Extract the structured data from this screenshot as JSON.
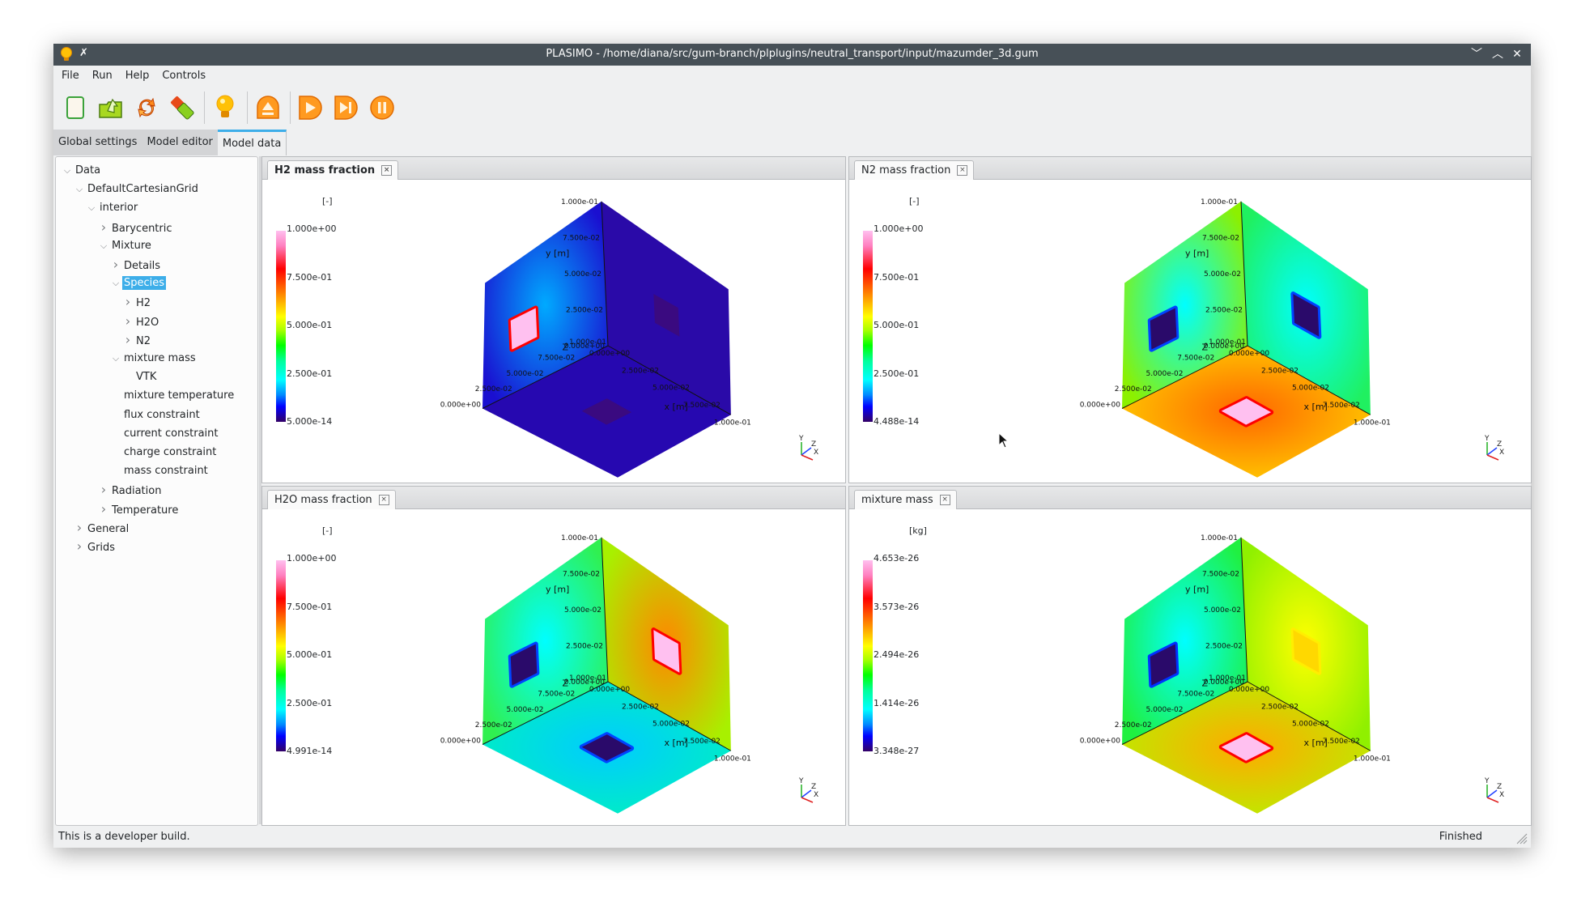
{
  "window": {
    "title": "PLASIMO - /home/diana/src/gum-branch/plplugins/neutral_transport/input/mazumder_3d.gum",
    "controls": [
      "minimize-icon",
      "maximize-icon",
      "close-icon"
    ]
  },
  "menu": [
    "File",
    "Run",
    "Help",
    "Controls"
  ],
  "toolbar": [
    {
      "name": "new-document-icon",
      "label": "New"
    },
    {
      "name": "open-folder-icon",
      "label": "Open"
    },
    {
      "name": "reload-icon",
      "label": "Reload"
    },
    {
      "name": "usb-stick-icon",
      "label": "Save"
    },
    {
      "name": "lightbulb-icon",
      "label": "Hint"
    },
    {
      "name": "eject-icon",
      "label": "Eject"
    },
    {
      "name": "play-icon",
      "label": "Run"
    },
    {
      "name": "step-icon",
      "label": "Step"
    },
    {
      "name": "pause-icon",
      "label": "Pause"
    }
  ],
  "tabs": [
    {
      "label": "Global settings",
      "active": false
    },
    {
      "label": "Model editor",
      "active": false
    },
    {
      "label": "Model data",
      "active": true
    }
  ],
  "tree": [
    {
      "label": "Data",
      "level": 0,
      "expander": "open"
    },
    {
      "label": "DefaultCartesianGrid",
      "level": 1,
      "expander": "open"
    },
    {
      "label": "interior",
      "level": 2,
      "expander": "open"
    },
    {
      "label": "Barycentric",
      "level": 3,
      "expander": "closed"
    },
    {
      "label": "Mixture",
      "level": 3,
      "expander": "open"
    },
    {
      "label": "Details",
      "level": 4,
      "expander": "closed"
    },
    {
      "label": "Species",
      "level": 4,
      "expander": "open",
      "selected": true
    },
    {
      "label": "H2",
      "level": 5,
      "expander": "closed"
    },
    {
      "label": "H2O",
      "level": 5,
      "expander": "closed"
    },
    {
      "label": "N2",
      "level": 5,
      "expander": "closed"
    },
    {
      "label": "mixture mass",
      "level": 4,
      "expander": "open"
    },
    {
      "label": "VTK",
      "level": 5,
      "expander": "none"
    },
    {
      "label": "mixture temperature",
      "level": 4,
      "expander": "none"
    },
    {
      "label": "flux constraint",
      "level": 4,
      "expander": "none"
    },
    {
      "label": "current constraint",
      "level": 4,
      "expander": "none"
    },
    {
      "label": "charge constraint",
      "level": 4,
      "expander": "none"
    },
    {
      "label": "mass constraint",
      "level": 4,
      "expander": "none"
    },
    {
      "label": "Radiation",
      "level": 3,
      "expander": "closed"
    },
    {
      "label": "Temperature",
      "level": 3,
      "expander": "closed"
    },
    {
      "label": "General",
      "level": 1,
      "expander": "closed"
    },
    {
      "label": "Grids",
      "level": 1,
      "expander": "closed"
    }
  ],
  "panels": [
    {
      "tab": "H2 mass fraction",
      "active": true,
      "unit": "[-]",
      "colorbar": [
        "1.000e+00",
        "7.500e-01",
        "5.000e-01",
        "2.500e-01",
        "5.000e-14"
      ],
      "faces": {
        "left": "#1a0fd0",
        "right": "#2a0aa8",
        "bottom": "#2608b0"
      },
      "source_left": {
        "color": "#ffc0f0",
        "ring": "#ff0000",
        "halo": "#00aaff"
      },
      "source_right": {
        "color": "#3a0a80"
      },
      "source_bottom": {
        "color": "#3a0a80"
      }
    },
    {
      "tab": "N2 mass fraction",
      "active": false,
      "unit": "[-]",
      "colorbar": [
        "1.000e+00",
        "7.500e-01",
        "5.000e-01",
        "2.500e-01",
        "4.488e-14"
      ],
      "faces": {
        "left": "#8cf000",
        "right": "#20f060",
        "bottom": "#ffd000"
      },
      "source_left": {
        "color": "#2a0a6a",
        "ring": "#0044ff",
        "halo": "#00ffff"
      },
      "source_right": {
        "color": "#2a0a6a",
        "ring": "#0044ff",
        "halo": "#00ffff"
      },
      "source_bottom": {
        "color": "#ffc0f0",
        "ring": "#ff0000",
        "halo": "#ff6600"
      }
    },
    {
      "tab": "H2O mass fraction",
      "active": false,
      "unit": "[-]",
      "colorbar": [
        "1.000e+00",
        "7.500e-01",
        "5.000e-01",
        "2.500e-01",
        "4.991e-14"
      ],
      "faces": {
        "left": "#30f050",
        "right": "#a8f000",
        "bottom": "#00f0c0"
      },
      "source_left": {
        "color": "#2a0a6a",
        "ring": "#0044ff",
        "halo": "#00ffff"
      },
      "source_right": {
        "color": "#ffc0f0",
        "ring": "#ff0000",
        "halo": "#ff8800"
      },
      "source_bottom": {
        "color": "#2a0a6a",
        "ring": "#0044ff",
        "halo": "#00ccff"
      }
    },
    {
      "tab": "mixture mass",
      "active": false,
      "unit": "[kg]",
      "colorbar": [
        "4.653e-26",
        "3.573e-26",
        "2.494e-26",
        "1.414e-26",
        "3.348e-27"
      ],
      "faces": {
        "left": "#20f040",
        "right": "#90f000",
        "bottom": "#b8f000"
      },
      "source_left": {
        "color": "#2a0a6a",
        "ring": "#0033ff",
        "halo": "#00ffff"
      },
      "source_right": {
        "color": "#ffd800",
        "ring": "#ffee00",
        "halo": "#ffff00"
      },
      "source_bottom": {
        "color": "#ffc0f0",
        "ring": "#ff0000",
        "halo": "#ffaa00"
      }
    }
  ],
  "axes": {
    "x_label": "x [m]",
    "y_label": "y [m]",
    "z_label": "Z",
    "ticks": [
      "0.000e+00",
      "2.500e-02",
      "5.000e-02",
      "7.500e-02",
      "1.000e-01"
    ],
    "triad": [
      "Y",
      "Z",
      "X"
    ]
  },
  "status": {
    "message": "This is a developer build.",
    "state": "Finished"
  }
}
